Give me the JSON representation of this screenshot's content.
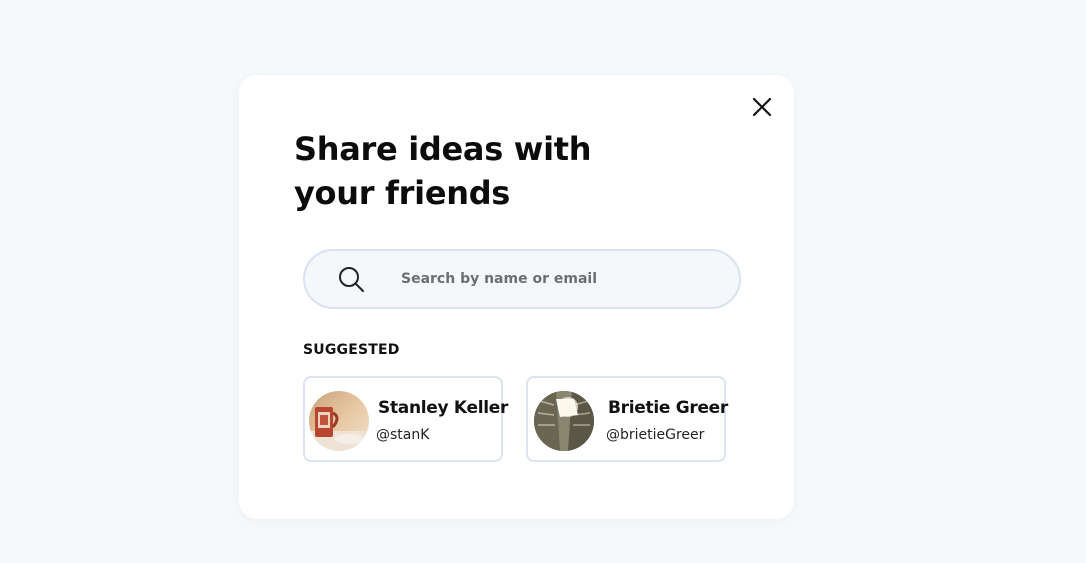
{
  "modal": {
    "title": "Share ideas with your friends",
    "close_icon": "close-icon"
  },
  "search": {
    "placeholder": "Search by name or email",
    "value": "",
    "icon": "search-icon"
  },
  "suggested": {
    "label": "SUGGESTED",
    "users": [
      {
        "name": "Stanley Keller",
        "handle": "@stanK"
      },
      {
        "name": "Brietie Greer",
        "handle": "@brietieGreer"
      }
    ]
  },
  "colors": {
    "page_background": "#f5f9fb",
    "modal_background": "#ffffff",
    "border": "#dce4f2",
    "search_background": "#f4f8fb",
    "text": "#111111",
    "placeholder": "#6e6e6e"
  }
}
